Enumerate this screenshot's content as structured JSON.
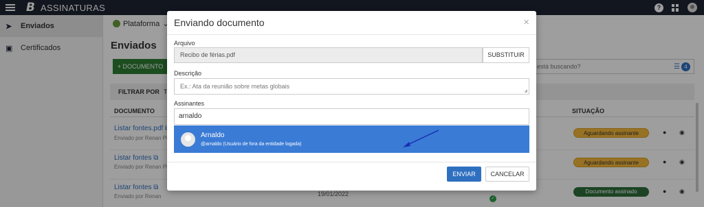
{
  "app": {
    "title": "ASSINATURAS",
    "logo": "B"
  },
  "sidebar": {
    "items": [
      {
        "label": "Enviados",
        "icon": "send-icon",
        "active": true
      },
      {
        "label": "Certificados",
        "icon": "certificate-icon",
        "active": false
      }
    ]
  },
  "page": {
    "breadcrumb": "Plataforma",
    "title": "Enviados",
    "add_button": "+ DOCUMENTO",
    "search_placeholder": "está buscando?",
    "filter_count": "4",
    "filter_label": "FILTRAR POR",
    "filter_value": "To",
    "columns": {
      "document": "DOCUMENTO",
      "status": "SITUAÇÃO"
    },
    "rows": [
      {
        "name": "Listar fontes.pdf",
        "sender": "Enviado por Renan Piz",
        "status": "Aguardando assinante"
      },
      {
        "name": "Listar fontes",
        "sender": "Enviado por Renan Pi",
        "status": "Aguardando assinante"
      },
      {
        "name": "Listar fontes",
        "sender": "Enviado por Renan",
        "status": "Documento assinado",
        "date": "19/01/2022"
      }
    ]
  },
  "modal": {
    "title": "Enviando documento",
    "close": "×",
    "file_label": "Arquivo",
    "file_value": "Recibo de férias.pdf",
    "replace_button": "SUBSTITUIR",
    "description_label": "Descrição",
    "description_placeholder": "Ex.: Ata da reunião sobre metas globais",
    "signers_label": "Assinantes",
    "signers_value": "arnaldo",
    "suggestion": {
      "name": "Arnaldo",
      "detail": "@arnaldo (Usuário de fora da entidade logada)"
    },
    "send_button": "ENVIAR",
    "cancel_button": "CANCELAR"
  },
  "colors": {
    "topbar": "#1d2533",
    "primary": "#2f6fbf",
    "suggestion": "#3a7bd5",
    "success": "#2e7d32",
    "warning": "#f5b93a"
  }
}
